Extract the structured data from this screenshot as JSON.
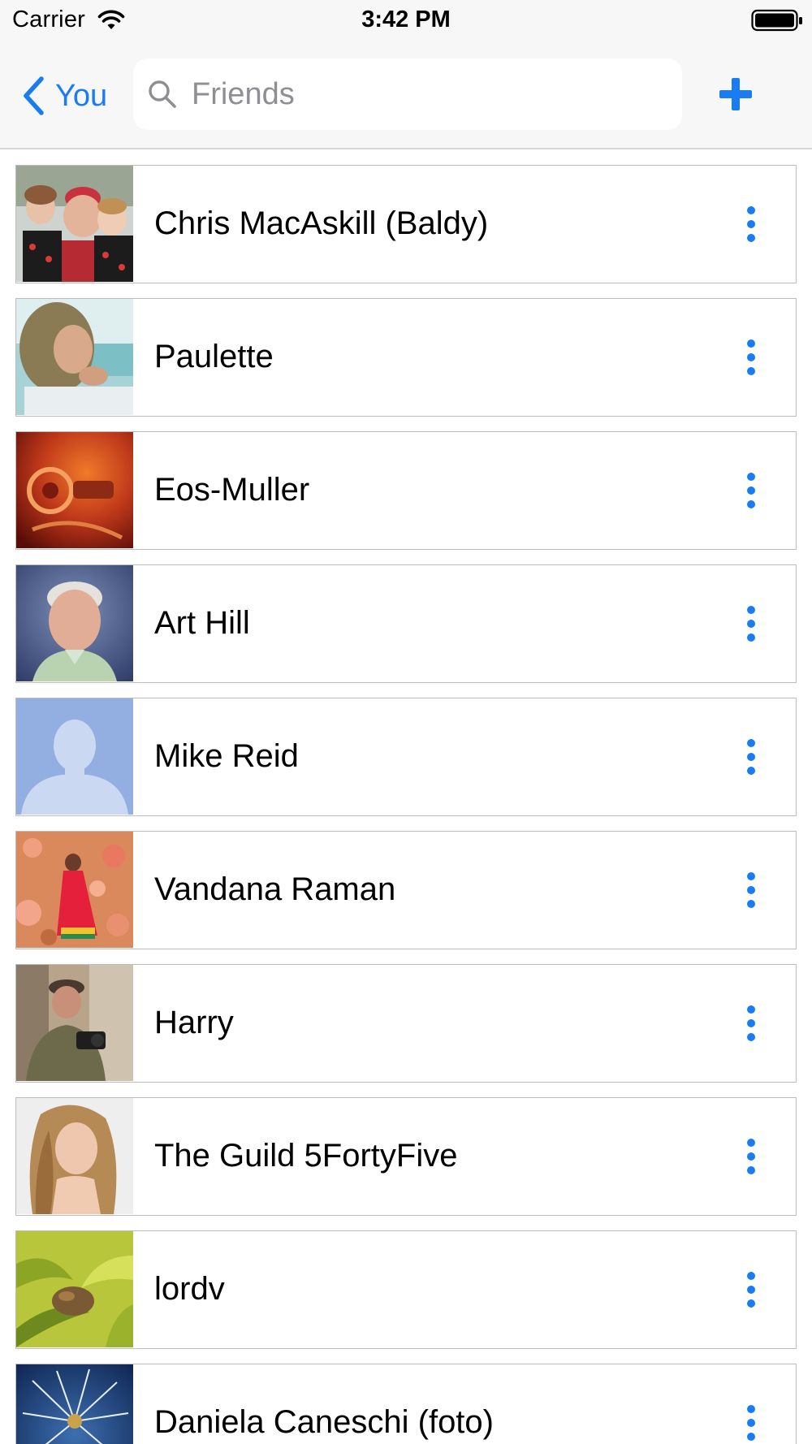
{
  "status_bar": {
    "carrier": "Carrier",
    "time": "3:42 PM"
  },
  "nav": {
    "back_label": "You",
    "search_placeholder": "Friends"
  },
  "colors": {
    "accent": "#1a7cf2",
    "bar_background": "#f7f7f7",
    "row_border": "#bdbdbd"
  },
  "friends": [
    {
      "name": "Chris MacAskill (Baldy)"
    },
    {
      "name": "Paulette"
    },
    {
      "name": "Eos-Muller"
    },
    {
      "name": "Art Hill"
    },
    {
      "name": "Mike Reid"
    },
    {
      "name": "Vandana Raman"
    },
    {
      "name": "Harry"
    },
    {
      "name": "The Guild 5FortyFive"
    },
    {
      "name": "lordv"
    },
    {
      "name": "Daniela Caneschi (foto)"
    }
  ],
  "icons": {
    "back": "chevron-left-icon",
    "search": "magnifier-icon",
    "add": "plus-icon",
    "more": "vertical-ellipsis-icon"
  }
}
